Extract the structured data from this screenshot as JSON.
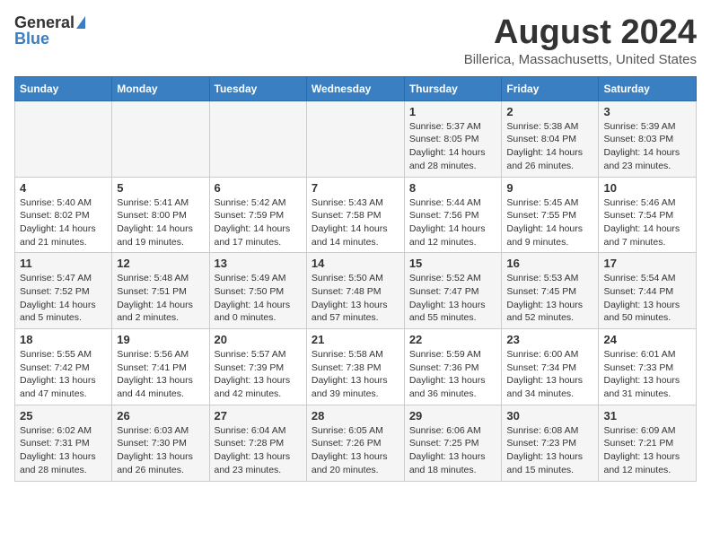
{
  "header": {
    "logo_general": "General",
    "logo_blue": "Blue",
    "main_title": "August 2024",
    "subtitle": "Billerica, Massachusetts, United States"
  },
  "calendar": {
    "days_of_week": [
      "Sunday",
      "Monday",
      "Tuesday",
      "Wednesday",
      "Thursday",
      "Friday",
      "Saturday"
    ],
    "weeks": [
      [
        {
          "day": "",
          "detail": ""
        },
        {
          "day": "",
          "detail": ""
        },
        {
          "day": "",
          "detail": ""
        },
        {
          "day": "",
          "detail": ""
        },
        {
          "day": "1",
          "detail": "Sunrise: 5:37 AM\nSunset: 8:05 PM\nDaylight: 14 hours\nand 28 minutes."
        },
        {
          "day": "2",
          "detail": "Sunrise: 5:38 AM\nSunset: 8:04 PM\nDaylight: 14 hours\nand 26 minutes."
        },
        {
          "day": "3",
          "detail": "Sunrise: 5:39 AM\nSunset: 8:03 PM\nDaylight: 14 hours\nand 23 minutes."
        }
      ],
      [
        {
          "day": "4",
          "detail": "Sunrise: 5:40 AM\nSunset: 8:02 PM\nDaylight: 14 hours\nand 21 minutes."
        },
        {
          "day": "5",
          "detail": "Sunrise: 5:41 AM\nSunset: 8:00 PM\nDaylight: 14 hours\nand 19 minutes."
        },
        {
          "day": "6",
          "detail": "Sunrise: 5:42 AM\nSunset: 7:59 PM\nDaylight: 14 hours\nand 17 minutes."
        },
        {
          "day": "7",
          "detail": "Sunrise: 5:43 AM\nSunset: 7:58 PM\nDaylight: 14 hours\nand 14 minutes."
        },
        {
          "day": "8",
          "detail": "Sunrise: 5:44 AM\nSunset: 7:56 PM\nDaylight: 14 hours\nand 12 minutes."
        },
        {
          "day": "9",
          "detail": "Sunrise: 5:45 AM\nSunset: 7:55 PM\nDaylight: 14 hours\nand 9 minutes."
        },
        {
          "day": "10",
          "detail": "Sunrise: 5:46 AM\nSunset: 7:54 PM\nDaylight: 14 hours\nand 7 minutes."
        }
      ],
      [
        {
          "day": "11",
          "detail": "Sunrise: 5:47 AM\nSunset: 7:52 PM\nDaylight: 14 hours\nand 5 minutes."
        },
        {
          "day": "12",
          "detail": "Sunrise: 5:48 AM\nSunset: 7:51 PM\nDaylight: 14 hours\nand 2 minutes."
        },
        {
          "day": "13",
          "detail": "Sunrise: 5:49 AM\nSunset: 7:50 PM\nDaylight: 14 hours\nand 0 minutes."
        },
        {
          "day": "14",
          "detail": "Sunrise: 5:50 AM\nSunset: 7:48 PM\nDaylight: 13 hours\nand 57 minutes."
        },
        {
          "day": "15",
          "detail": "Sunrise: 5:52 AM\nSunset: 7:47 PM\nDaylight: 13 hours\nand 55 minutes."
        },
        {
          "day": "16",
          "detail": "Sunrise: 5:53 AM\nSunset: 7:45 PM\nDaylight: 13 hours\nand 52 minutes."
        },
        {
          "day": "17",
          "detail": "Sunrise: 5:54 AM\nSunset: 7:44 PM\nDaylight: 13 hours\nand 50 minutes."
        }
      ],
      [
        {
          "day": "18",
          "detail": "Sunrise: 5:55 AM\nSunset: 7:42 PM\nDaylight: 13 hours\nand 47 minutes."
        },
        {
          "day": "19",
          "detail": "Sunrise: 5:56 AM\nSunset: 7:41 PM\nDaylight: 13 hours\nand 44 minutes."
        },
        {
          "day": "20",
          "detail": "Sunrise: 5:57 AM\nSunset: 7:39 PM\nDaylight: 13 hours\nand 42 minutes."
        },
        {
          "day": "21",
          "detail": "Sunrise: 5:58 AM\nSunset: 7:38 PM\nDaylight: 13 hours\nand 39 minutes."
        },
        {
          "day": "22",
          "detail": "Sunrise: 5:59 AM\nSunset: 7:36 PM\nDaylight: 13 hours\nand 36 minutes."
        },
        {
          "day": "23",
          "detail": "Sunrise: 6:00 AM\nSunset: 7:34 PM\nDaylight: 13 hours\nand 34 minutes."
        },
        {
          "day": "24",
          "detail": "Sunrise: 6:01 AM\nSunset: 7:33 PM\nDaylight: 13 hours\nand 31 minutes."
        }
      ],
      [
        {
          "day": "25",
          "detail": "Sunrise: 6:02 AM\nSunset: 7:31 PM\nDaylight: 13 hours\nand 28 minutes."
        },
        {
          "day": "26",
          "detail": "Sunrise: 6:03 AM\nSunset: 7:30 PM\nDaylight: 13 hours\nand 26 minutes."
        },
        {
          "day": "27",
          "detail": "Sunrise: 6:04 AM\nSunset: 7:28 PM\nDaylight: 13 hours\nand 23 minutes."
        },
        {
          "day": "28",
          "detail": "Sunrise: 6:05 AM\nSunset: 7:26 PM\nDaylight: 13 hours\nand 20 minutes."
        },
        {
          "day": "29",
          "detail": "Sunrise: 6:06 AM\nSunset: 7:25 PM\nDaylight: 13 hours\nand 18 minutes."
        },
        {
          "day": "30",
          "detail": "Sunrise: 6:08 AM\nSunset: 7:23 PM\nDaylight: 13 hours\nand 15 minutes."
        },
        {
          "day": "31",
          "detail": "Sunrise: 6:09 AM\nSunset: 7:21 PM\nDaylight: 13 hours\nand 12 minutes."
        }
      ]
    ]
  }
}
